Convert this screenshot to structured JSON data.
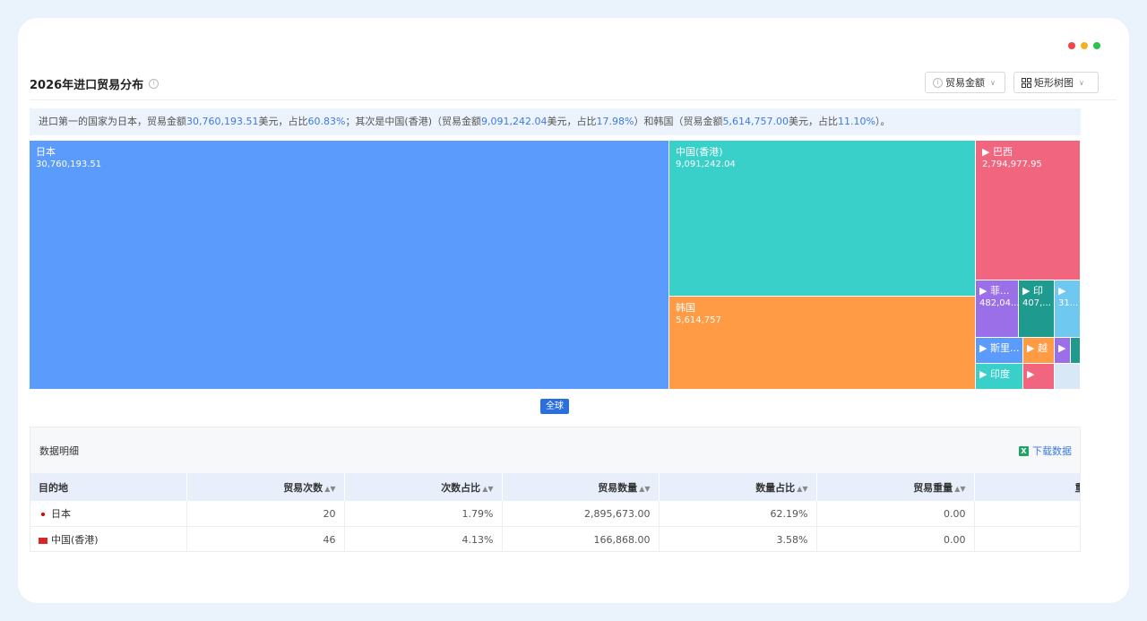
{
  "window": {
    "dot_colors": [
      "#f04646",
      "#f5b020",
      "#2bc24a"
    ]
  },
  "header": {
    "title": "2026年进口贸易分布",
    "metric_select": "贸易金额",
    "chart_select": "矩形树图"
  },
  "summary": {
    "p1": "进口第一的国家为日本，贸易金额",
    "v1": "30,760,193.51",
    "p2": "美元，占比",
    "v2": "60.83%",
    "p3": "；其次是中国(香港)（贸易金额",
    "v3": "9,091,242.04",
    "p4": "美元，占比",
    "v4": "17.98%",
    "p5": "）和韩国（贸易金额",
    "v5": "5,614,757.00",
    "p6": "美元，占比",
    "v6": "11.10%",
    "p7": "）。"
  },
  "treemap": {
    "tiles": [
      {
        "name": "日本",
        "value": "30,760,193.51",
        "color": "#5b9bfc"
      },
      {
        "name": "中国(香港)",
        "value": "9,091,242.04",
        "color": "#38d0c9"
      },
      {
        "name": "韩国",
        "value": "5,614,757",
        "color": "#ff9a45"
      },
      {
        "name": "▶ 巴西",
        "value": "2,794,977.95",
        "color": "#f2657f"
      },
      {
        "name": "▶ 菲...",
        "value": "482,04...",
        "color": "#9b6fe8"
      },
      {
        "name": "▶ 印",
        "value": "407,...",
        "color": "#1f9a8e"
      },
      {
        "name": "▶",
        "value": "31...",
        "color": "#6ec8f0"
      },
      {
        "name": "▶ 斯里...",
        "value": "",
        "color": "#5b9bfc"
      },
      {
        "name": "▶ 越",
        "value": "",
        "color": "#ff9a45"
      },
      {
        "name": "▶",
        "value": "",
        "color": "#9b6fe8"
      },
      {
        "name": "▶ 印度",
        "value": "",
        "color": "#38d0c9"
      },
      {
        "name": "▶",
        "value": "",
        "color": "#f2657f"
      }
    ],
    "scope_button": "全球"
  },
  "table": {
    "title": "数据明细",
    "download": "下载数据",
    "columns": [
      "目的地",
      "贸易次数",
      "次数占比",
      "贸易数量",
      "数量占比",
      "贸易重量",
      "重"
    ],
    "rows": [
      {
        "flag": "jp",
        "cells": [
          "日本",
          "20",
          "1.79%",
          "2,895,673.00",
          "62.19%",
          "0.00",
          ""
        ]
      },
      {
        "flag": "hk",
        "cells": [
          "中国(香港)",
          "46",
          "4.13%",
          "166,868.00",
          "3.58%",
          "0.00",
          ""
        ]
      }
    ]
  }
}
